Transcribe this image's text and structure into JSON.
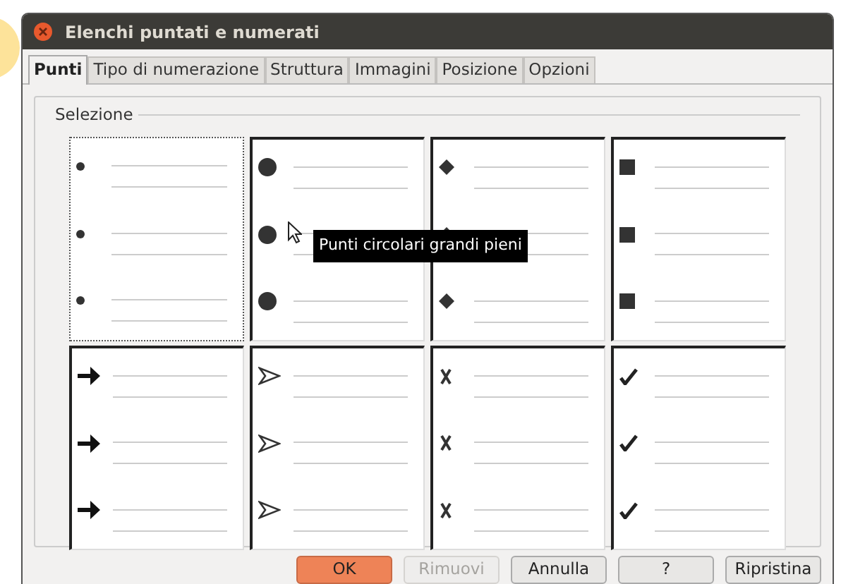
{
  "window": {
    "title": "Elenchi puntati e numerati"
  },
  "tabs": [
    {
      "label": "Punti",
      "selected": true
    },
    {
      "label": "Tipo di numerazione",
      "selected": false
    },
    {
      "label": "Struttura",
      "selected": false
    },
    {
      "label": "Immagini",
      "selected": false
    },
    {
      "label": "Posizione",
      "selected": false
    },
    {
      "label": "Opzioni",
      "selected": false
    }
  ],
  "selection": {
    "title": "Selezione",
    "cells": [
      {
        "kind": "small-dot",
        "selected": true
      },
      {
        "kind": "big-dot",
        "selected": false
      },
      {
        "kind": "diamond",
        "selected": false
      },
      {
        "kind": "square",
        "selected": false
      },
      {
        "kind": "arrow",
        "selected": false
      },
      {
        "kind": "arrowhead",
        "selected": false
      },
      {
        "kind": "cross",
        "selected": false
      },
      {
        "kind": "check",
        "selected": false
      }
    ],
    "tooltip": "Punti circolari grandi pieni"
  },
  "buttons": [
    {
      "label": "OK",
      "default": true,
      "disabled": false
    },
    {
      "label": "Rimuovi",
      "default": false,
      "disabled": true
    },
    {
      "label": "Annulla",
      "default": false,
      "disabled": false
    },
    {
      "label": "?",
      "default": false,
      "disabled": false
    },
    {
      "label": "Ripristina",
      "default": false,
      "disabled": false
    }
  ]
}
